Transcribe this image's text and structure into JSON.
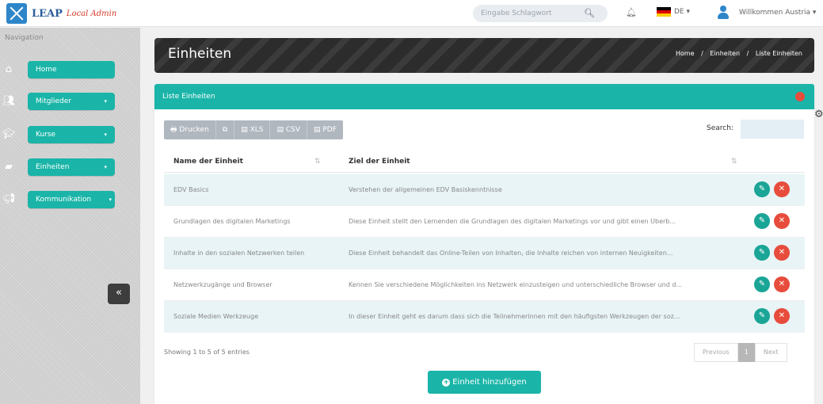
{
  "topbar": {
    "brand": "LEAP",
    "brand_sub": "Local Admin",
    "search_placeholder": "Eingabe Schlagwort",
    "language": "DE ▾",
    "user_greeting": "Willkommen Austria ▾"
  },
  "sidebar": {
    "title": "Navigation",
    "items": [
      {
        "label": "Home",
        "caret": ""
      },
      {
        "label": "Mitglieder",
        "caret": "▾"
      },
      {
        "label": "Kurse",
        "caret": "▾"
      },
      {
        "label": "Einheiten",
        "caret": "▾"
      },
      {
        "label": "Kommunikation",
        "caret": "▾"
      }
    ],
    "collapse_label": "«"
  },
  "banner": {
    "title": "Einheiten",
    "breadcrumb": [
      "Home",
      "Einheiten",
      "Liste Einheiten"
    ],
    "separator": "/"
  },
  "panel": {
    "title": "Liste Einheiten",
    "toolbar": [
      {
        "label": "🖶 Drucken"
      },
      {
        "label": "⧉"
      },
      {
        "label": "▤ XLS"
      },
      {
        "label": "▤ CSV"
      },
      {
        "label": "▤ PDF"
      }
    ],
    "search_label": "Search:",
    "columns": [
      "Name der Einheit",
      "Ziel der Einheit"
    ],
    "rows": [
      {
        "name": "EDV Basics",
        "goal": "Verstehen der allgemeinen EDV Basiskenntnisse"
      },
      {
        "name": "Grundlagen des digitalen Marketings",
        "goal": "Diese Einheit stellt den Lernenden die Grundlagen des digitalen Marketings vor und gibt einen Überb..."
      },
      {
        "name": "Inhalte in den sozialen Netzwerken teilen",
        "goal": "Diese Einheit behandelt das Online-Teilen von Inhalten, die Inhalte reichen von internen Neuigkeiten..."
      },
      {
        "name": "Netzwerkzugänge und Browser",
        "goal": "Kennen Sie verschiedene Möglichkeiten ins Netzwerk einzusteigen und unterschiedliche Browser und d..."
      },
      {
        "name": "Soziale Medien Werkzeuge",
        "goal": "In dieser Einheit geht es darum dass sich die Teilnehmerinnen mit den häufigsten Werkzeugen der soz..."
      }
    ],
    "info": "Showing 1 to 5 of 5 entries",
    "pager": {
      "previous": "Previous",
      "current": "1",
      "next": "Next"
    },
    "add_button": "Einheit hinzufügen"
  },
  "colors": {
    "accent": "#1ab5a8",
    "danger": "#e74c3c",
    "banner": "#2c2c2c"
  }
}
